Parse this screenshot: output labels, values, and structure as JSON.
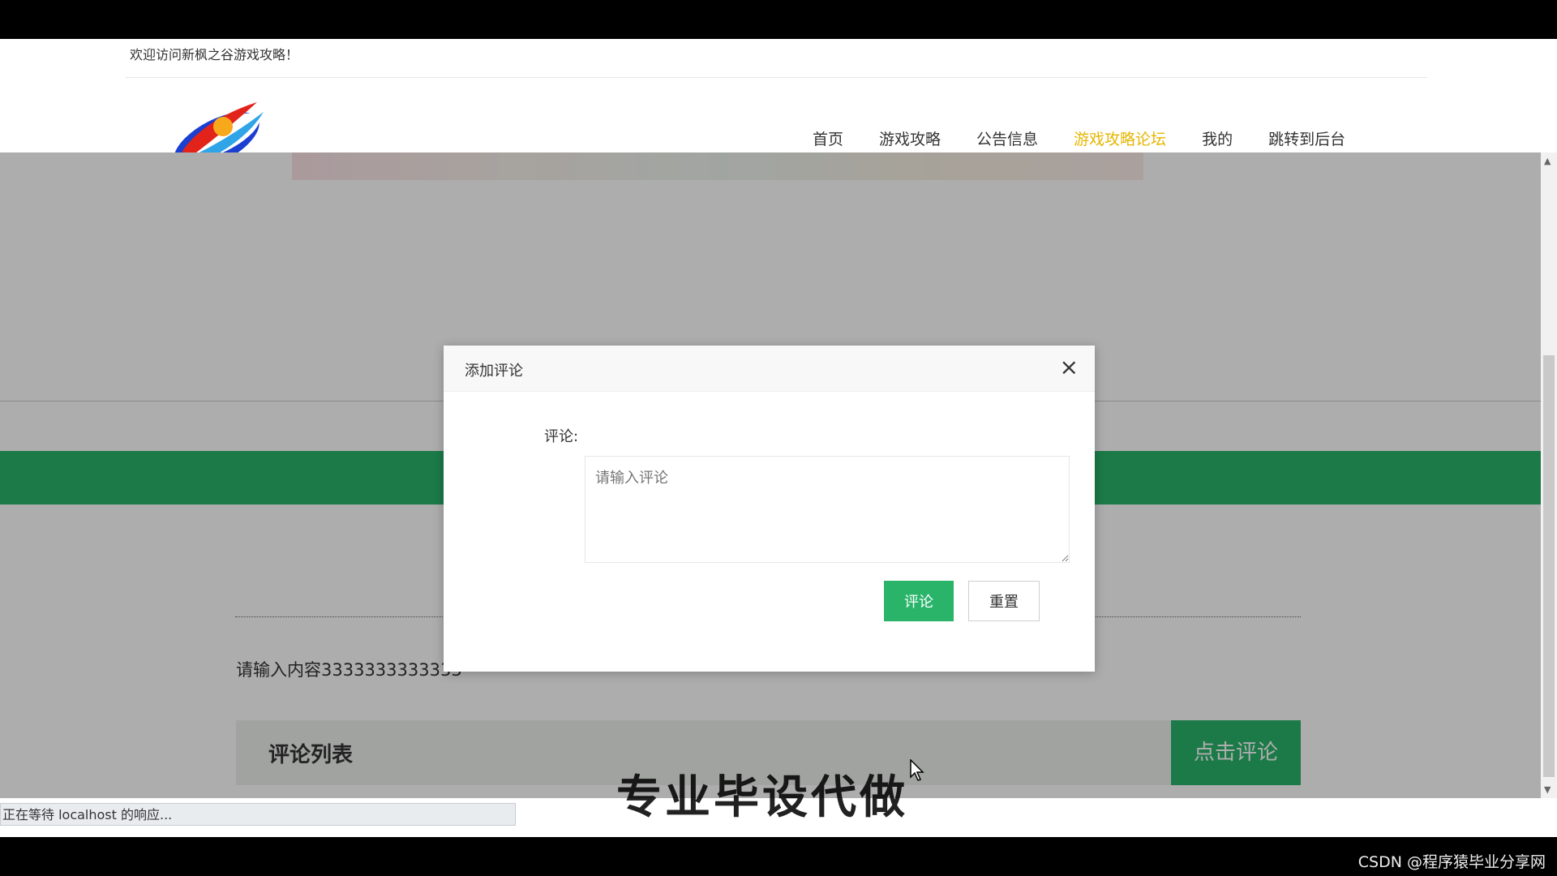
{
  "header": {
    "welcome": "欢迎访问新枫之谷游戏攻略！",
    "nav": [
      {
        "label": "首页",
        "active": false
      },
      {
        "label": "游戏攻略",
        "active": false
      },
      {
        "label": "公告信息",
        "active": false
      },
      {
        "label": "游戏攻略论坛",
        "active": true
      },
      {
        "label": "我的",
        "active": false
      },
      {
        "label": "跳转到后台",
        "active": false
      }
    ]
  },
  "page": {
    "content_text": "请输入内容3333333333333",
    "comment_list_title": "评论列表",
    "comment_button": "点击评论",
    "watermark": "专业毕设代做"
  },
  "modal": {
    "title": "添加评论",
    "close_icon": "×",
    "field_label": "评论:",
    "textarea_placeholder": "请输入评论",
    "submit_label": "评论",
    "reset_label": "重置"
  },
  "status_bar": "正在等待 localhost 的响应...",
  "credit": "CSDN @程序猿毕业分享网",
  "colors": {
    "accent_green": "#29b46a",
    "nav_active": "#e6b600"
  }
}
